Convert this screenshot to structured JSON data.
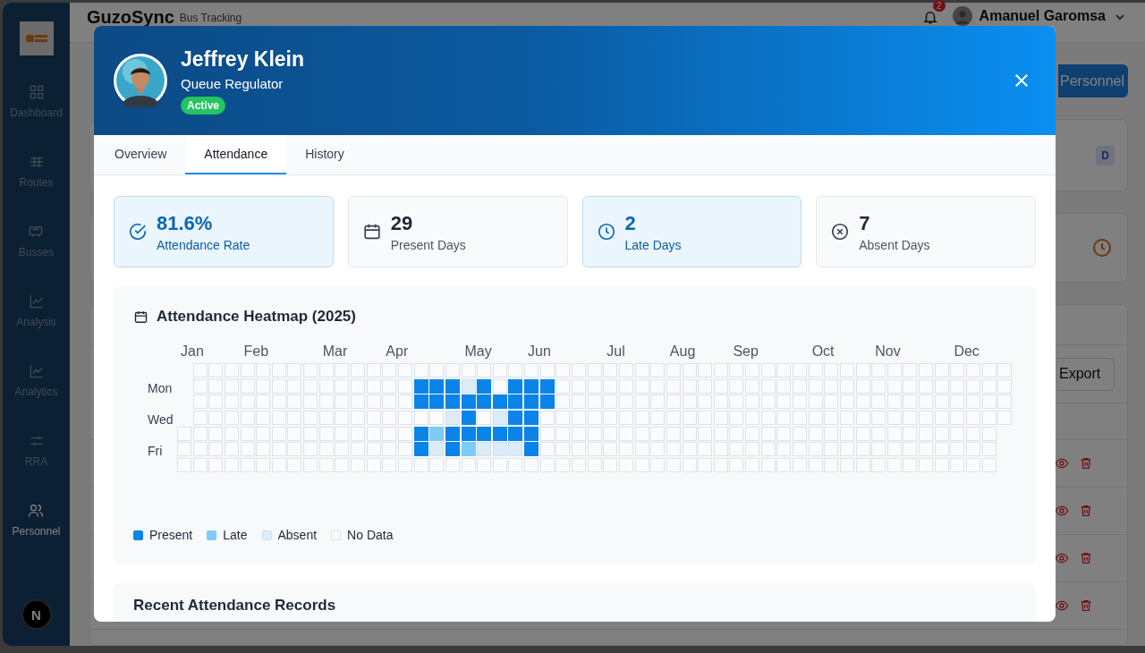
{
  "sidebar": {
    "items": [
      {
        "label": "Dashboard",
        "kind": "grid",
        "selected": false
      },
      {
        "label": "Routes",
        "kind": "routes",
        "selected": false
      },
      {
        "label": "Busses",
        "kind": "bus",
        "selected": false
      },
      {
        "label": "Analysis",
        "kind": "chart",
        "selected": false
      },
      {
        "label": "Analytics",
        "kind": "chart",
        "selected": false
      },
      {
        "label": "RRA",
        "kind": "sliders",
        "selected": false
      },
      {
        "label": "Personnel",
        "kind": "users",
        "selected": true
      }
    ],
    "dev_badge": "N"
  },
  "topbar": {
    "brand": "GuzoSync",
    "tagline": "Bus Tracking",
    "notifications": "2",
    "user": "Amanuel Garomsa"
  },
  "page": {
    "add_button": "Personnel",
    "card_badge": "D",
    "export_button": "Export",
    "rows": [
      {
        "actions": [
          {
            "kind": "view"
          },
          {
            "kind": "delete"
          }
        ]
      },
      {
        "actions": [
          {
            "kind": "view"
          },
          {
            "kind": "delete"
          }
        ]
      },
      {
        "actions": [
          {
            "kind": "view"
          },
          {
            "kind": "delete"
          }
        ]
      },
      {
        "actions": [
          {
            "kind": "view"
          },
          {
            "kind": "delete"
          }
        ]
      }
    ]
  },
  "modal": {
    "name": "Jeffrey Klein",
    "role": "Queue Regulator",
    "status": "Active",
    "tabs": [
      {
        "label": "Overview",
        "selected": false
      },
      {
        "label": "Attendance",
        "selected": true
      },
      {
        "label": "History",
        "selected": false
      }
    ],
    "stats": [
      {
        "value": "81.6%",
        "label": "Attendance Rate",
        "kind": "check",
        "highlighted": true
      },
      {
        "value": "29",
        "label": "Present Days",
        "kind": "calendar",
        "highlighted": false
      },
      {
        "value": "2",
        "label": "Late Days",
        "kind": "clock",
        "highlighted": true
      },
      {
        "value": "7",
        "label": "Absent Days",
        "kind": "cross",
        "highlighted": false
      }
    ],
    "heatmap": {
      "title": "Attendance Heatmap (2025)",
      "months": [
        "Jan",
        "Feb",
        "Mar",
        "Apr",
        "May",
        "Jun",
        "Jul",
        "Aug",
        "Sep",
        "Oct",
        "Nov",
        "Dec"
      ],
      "day_labels": [
        "Mon",
        "Wed",
        "Fri"
      ],
      "weeks": [
        {
          "kind": "first"
        },
        {
          "kind": "blank"
        },
        {
          "kind": "blank"
        },
        {
          "kind": "blank"
        },
        {
          "kind": "blank"
        },
        {
          "kind": "blank"
        },
        {
          "kind": "blank"
        },
        {
          "kind": "blank"
        },
        {
          "kind": "blank"
        },
        {
          "kind": "blank"
        },
        {
          "kind": "blank"
        },
        {
          "kind": "blank"
        },
        {
          "kind": "blank"
        },
        {
          "kind": "blank"
        },
        {
          "kind": "blank"
        },
        {
          "kind": "tracked",
          "days": [
            {
              "kind": "none"
            },
            {
              "kind": "present"
            },
            {
              "kind": "present"
            },
            {
              "kind": "none"
            },
            {
              "kind": "present"
            },
            {
              "kind": "present"
            },
            {
              "kind": "none"
            }
          ]
        },
        {
          "kind": "tracked",
          "days": [
            {
              "kind": "none"
            },
            {
              "kind": "present"
            },
            {
              "kind": "present"
            },
            {
              "kind": "none"
            },
            {
              "kind": "late"
            },
            {
              "kind": "absent"
            },
            {
              "kind": "none"
            }
          ]
        },
        {
          "kind": "tracked",
          "days": [
            {
              "kind": "none"
            },
            {
              "kind": "present"
            },
            {
              "kind": "present"
            },
            {
              "kind": "absent"
            },
            {
              "kind": "present"
            },
            {
              "kind": "present"
            },
            {
              "kind": "none"
            }
          ]
        },
        {
          "kind": "tracked",
          "days": [
            {
              "kind": "none"
            },
            {
              "kind": "absent"
            },
            {
              "kind": "present"
            },
            {
              "kind": "present"
            },
            {
              "kind": "present"
            },
            {
              "kind": "late"
            },
            {
              "kind": "none"
            }
          ]
        },
        {
          "kind": "tracked",
          "days": [
            {
              "kind": "none"
            },
            {
              "kind": "present"
            },
            {
              "kind": "present"
            },
            {
              "kind": "none"
            },
            {
              "kind": "present"
            },
            {
              "kind": "absent"
            },
            {
              "kind": "none"
            }
          ]
        },
        {
          "kind": "tracked",
          "days": [
            {
              "kind": "none"
            },
            {
              "kind": "none"
            },
            {
              "kind": "present"
            },
            {
              "kind": "absent"
            },
            {
              "kind": "present"
            },
            {
              "kind": "absent"
            },
            {
              "kind": "none"
            }
          ]
        },
        {
          "kind": "tracked",
          "days": [
            {
              "kind": "none"
            },
            {
              "kind": "present"
            },
            {
              "kind": "present"
            },
            {
              "kind": "present"
            },
            {
              "kind": "present"
            },
            {
              "kind": "absent"
            },
            {
              "kind": "none"
            }
          ]
        },
        {
          "kind": "tracked",
          "days": [
            {
              "kind": "none"
            },
            {
              "kind": "present"
            },
            {
              "kind": "present"
            },
            {
              "kind": "present"
            },
            {
              "kind": "present"
            },
            {
              "kind": "present"
            },
            {
              "kind": "none"
            }
          ]
        },
        {
          "kind": "tracked",
          "days": [
            {
              "kind": "none"
            },
            {
              "kind": "present"
            },
            {
              "kind": "present"
            },
            {
              "kind": "none"
            },
            {
              "kind": "none"
            },
            {
              "kind": "none"
            },
            {
              "kind": "none"
            }
          ]
        },
        {
          "kind": "blank"
        },
        {
          "kind": "blank"
        },
        {
          "kind": "blank"
        },
        {
          "kind": "blank"
        },
        {
          "kind": "blank"
        },
        {
          "kind": "blank"
        },
        {
          "kind": "blank"
        },
        {
          "kind": "blank"
        },
        {
          "kind": "blank"
        },
        {
          "kind": "blank"
        },
        {
          "kind": "blank"
        },
        {
          "kind": "blank"
        },
        {
          "kind": "blank"
        },
        {
          "kind": "blank"
        },
        {
          "kind": "blank"
        },
        {
          "kind": "blank"
        },
        {
          "kind": "blank"
        },
        {
          "kind": "blank"
        },
        {
          "kind": "blank"
        },
        {
          "kind": "blank"
        },
        {
          "kind": "blank"
        },
        {
          "kind": "blank"
        },
        {
          "kind": "blank"
        },
        {
          "kind": "blank"
        },
        {
          "kind": "blank"
        },
        {
          "kind": "blank"
        },
        {
          "kind": "blank"
        },
        {
          "kind": "blank"
        },
        {
          "kind": "last"
        }
      ],
      "legend": [
        {
          "label": "Present",
          "kind": "present"
        },
        {
          "label": "Late",
          "kind": "late"
        },
        {
          "label": "Absent",
          "kind": "absent"
        },
        {
          "label": "No Data",
          "kind": "none"
        }
      ]
    },
    "records_title": "Recent Attendance Records"
  }
}
